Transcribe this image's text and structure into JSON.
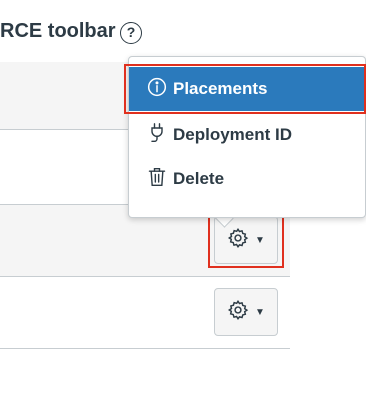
{
  "header": {
    "title": "RCE toolbar",
    "help_glyph": "?"
  },
  "menu": {
    "items": [
      {
        "label": "Placements",
        "icon": "info-icon",
        "selected": true
      },
      {
        "label": "Deployment ID",
        "icon": "plug-icon",
        "selected": false
      },
      {
        "label": "Delete",
        "icon": "trash-icon",
        "selected": false
      }
    ]
  },
  "rows": [
    {
      "settings_button_icon": "gear-icon"
    },
    {
      "settings_button_icon": "gear-icon"
    }
  ],
  "colors": {
    "accent": "#2b7abc",
    "highlight_outline": "#e0301e",
    "text": "#2d3b45",
    "border": "#c7cdd1"
  }
}
